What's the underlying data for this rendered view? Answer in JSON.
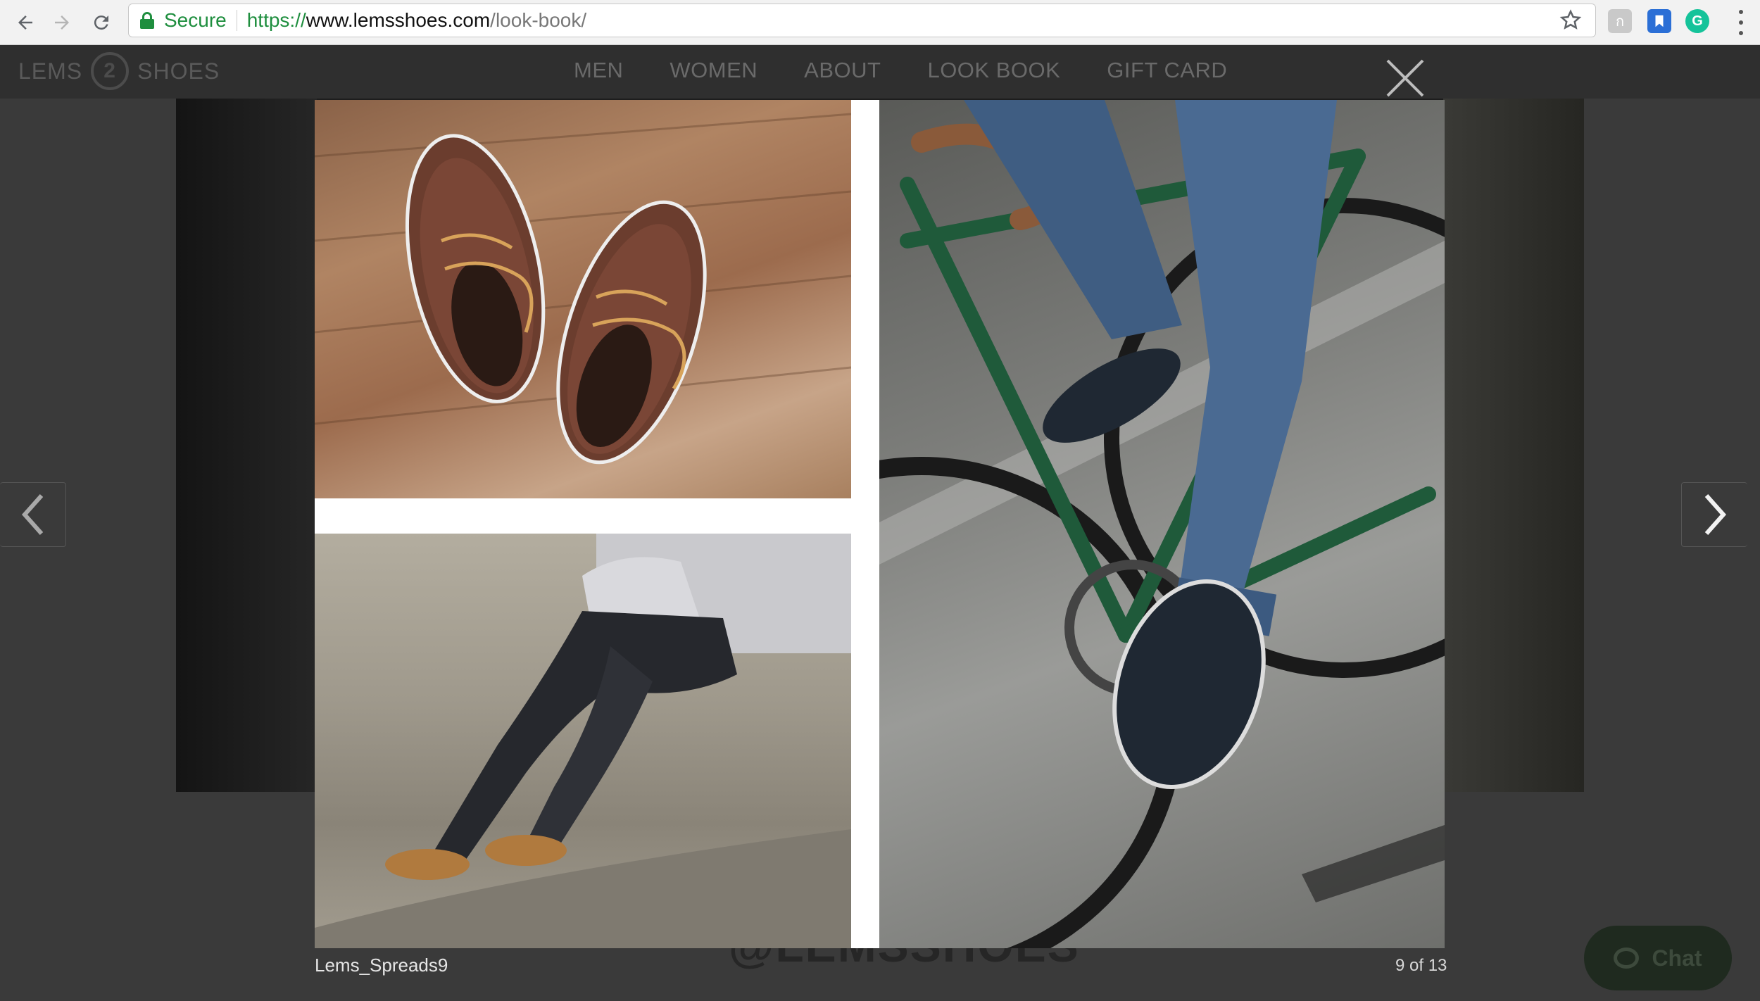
{
  "browser": {
    "secure_label": "Secure",
    "url_scheme": "https://",
    "url_host": "www.lemsshoes.com",
    "url_path": "/look-book/",
    "accent_green": "#1e8e3e"
  },
  "site": {
    "logo_left": "LEMS",
    "logo_right": "SHOES",
    "nav": [
      "MEN",
      "WOMEN",
      "ABOUT",
      "LOOK BOOK",
      "GIFT CARD"
    ],
    "background_handle": "@LEMSSHOES"
  },
  "lightbox": {
    "caption": "Lems_Spreads9",
    "counter": "9 of 13"
  },
  "chat": {
    "label": "Chat"
  }
}
